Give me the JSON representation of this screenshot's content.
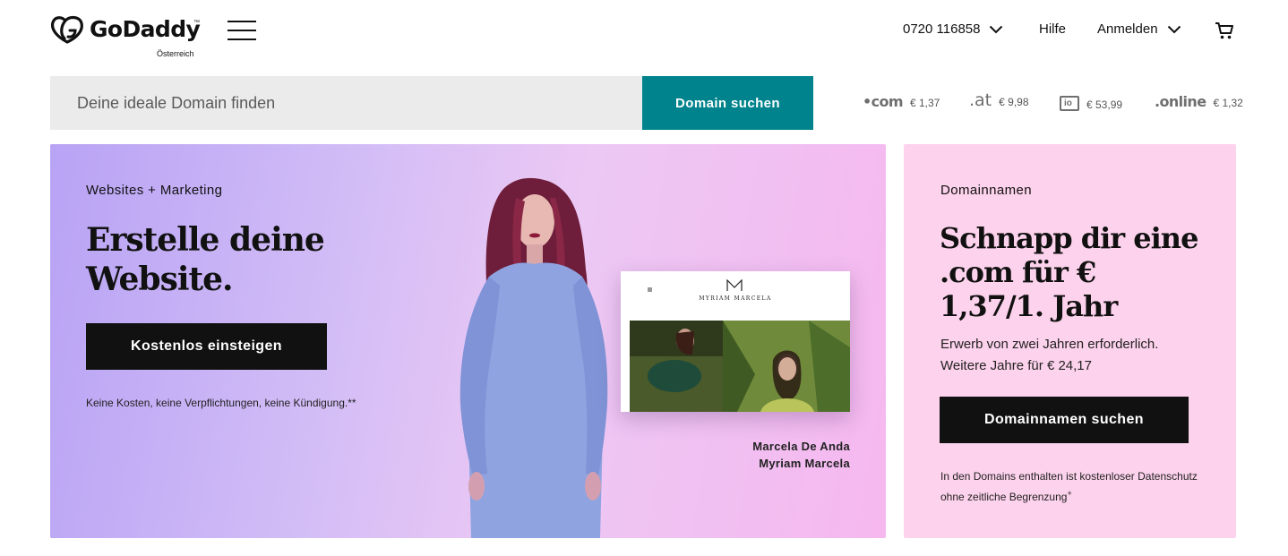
{
  "brand": {
    "name": "GoDaddy",
    "trademark": "™",
    "region": "Österreich"
  },
  "nav": {
    "phone": "0720 116858",
    "help": "Hilfe",
    "login": "Anmelden"
  },
  "search": {
    "placeholder": "Deine ideale Domain finden",
    "button": "Domain suchen"
  },
  "tlds": [
    {
      "name": "•com",
      "price": "€ 1,37"
    },
    {
      "name": ".at",
      "price": "€ 9,98"
    },
    {
      "name": "io",
      "price": "€ 53,99"
    },
    {
      "name": ".online",
      "price": "€ 1,32"
    }
  ],
  "hero": {
    "eyebrow": "Websites + Marketing",
    "title": "Erstelle deine Website.",
    "button": "Kostenlos einsteigen",
    "note": "Keine Kosten, keine Verpflichtungen, keine Kündigung.**",
    "site_name": "MYRIAM MARCELA",
    "credit_name": "Marcela De Anda",
    "credit_site": "Myriam Marcela"
  },
  "domain_card": {
    "eyebrow": "Domainnamen",
    "title": "Schnapp dir eine .com für € 1,37/1. Jahr",
    "sub_line1": "Erwerb von zwei Jahren erforderlich.",
    "sub_line2": "Weitere Jahre für € 24,17",
    "button": "Domainnamen suchen",
    "note": "In den Domains enthalten ist kostenloser Datenschutz ohne zeitliche Begrenzung",
    "note_mark": "+"
  },
  "colors": {
    "accent_teal": "#00838c",
    "hero_purple": "#b8a3f5",
    "hero_pink": "#f6b8ef",
    "domain_pink": "#fdd2ec",
    "button_dark": "#111111"
  },
  "icons": {
    "logo": "godaddy-logo-icon",
    "menu": "hamburger-menu-icon",
    "dropdown": "chevron-down-icon",
    "cart": "shopping-cart-icon"
  }
}
